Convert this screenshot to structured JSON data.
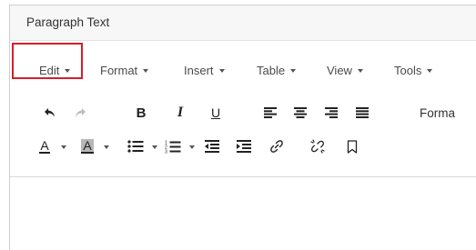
{
  "editor": {
    "title": "Paragraph Text"
  },
  "menubar": {
    "items": [
      {
        "label": "Edit",
        "highlighted": true
      },
      {
        "label": "Format"
      },
      {
        "label": "Insert"
      },
      {
        "label": "Table"
      },
      {
        "label": "View"
      },
      {
        "label": "Tools"
      }
    ]
  },
  "toolbar": {
    "row1": {
      "undo": "undo-icon",
      "redo": "redo-icon",
      "bold": "B",
      "italic": "I",
      "underline": "U",
      "align_left": "align-left-icon",
      "align_center": "align-center-icon",
      "align_right": "align-right-icon",
      "justify": "align-justify-icon",
      "formats_label": "Forma"
    },
    "row2": {
      "text_color_letter": "A",
      "background_color_letter": "A",
      "bullet_list": "bullet-list-icon",
      "numbered_list": "numbered-list-icon",
      "outdent": "outdent-icon",
      "indent": "indent-icon",
      "link": "link-icon",
      "unlink": "unlink-icon",
      "bookmark": "bookmark-icon"
    }
  },
  "colors": {
    "highlight_border": "#d51f2b",
    "text_color_underline": "#222222",
    "background_color_swatch": "#b7b7b7"
  }
}
